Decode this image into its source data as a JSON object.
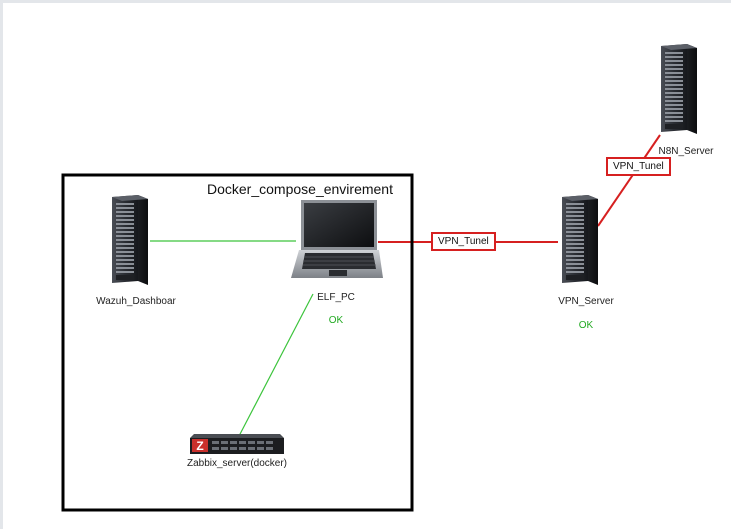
{
  "diagram": {
    "group": {
      "title": "Docker_compose_envirement"
    },
    "nodes": {
      "wazuh": {
        "label": "Wazuh_Dashboar"
      },
      "elf_pc": {
        "label": "ELF_PC",
        "status": "OK"
      },
      "zabbix": {
        "label": "Zabbix_server(docker)"
      },
      "vpn_server": {
        "label": "VPN_Server",
        "status": "OK"
      },
      "n8n": {
        "label": "N8N_Server"
      }
    },
    "links": {
      "elf_to_vpn": {
        "label": "VPN_Tunel"
      },
      "vpn_to_n8n": {
        "label": "VPN_Tunel"
      }
    }
  },
  "colors": {
    "local_link": "#3cc43c",
    "vpn_link": "#d62020",
    "status_ok": "#22aa22",
    "group_border": "#000000"
  }
}
